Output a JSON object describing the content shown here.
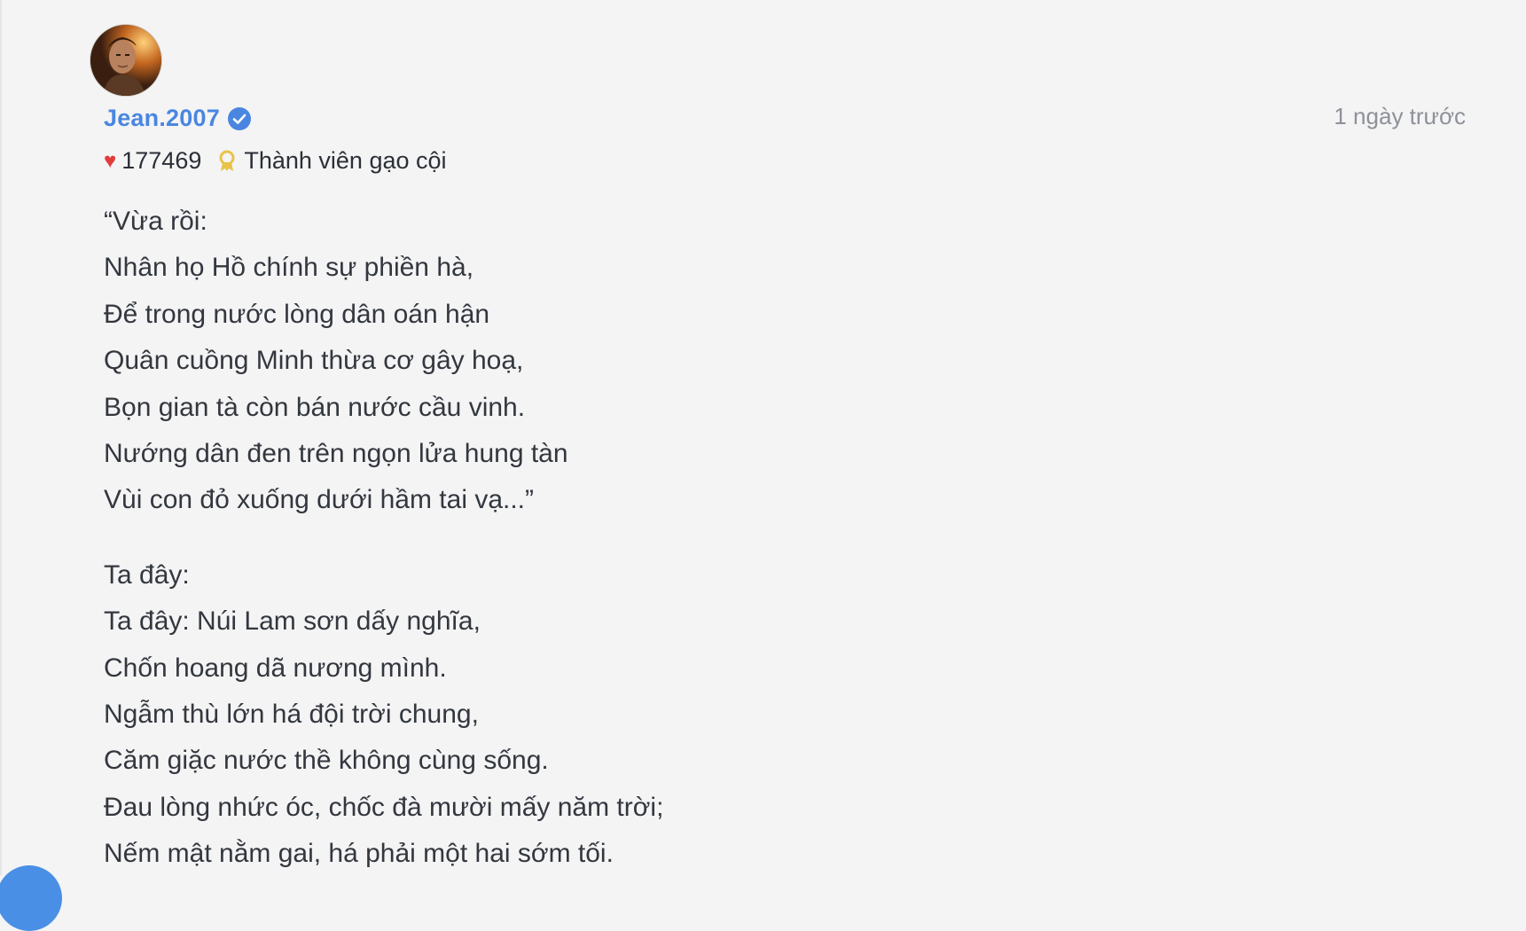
{
  "post": {
    "author": {
      "username": "Jean.2007",
      "verified": true,
      "likes": "177469",
      "rank": "Thành viên gạo cội"
    },
    "timestamp": "1 ngày trước",
    "stanzas": [
      {
        "lines": [
          "“Vừa rồi:",
          "Nhân họ Hồ chính sự phiền hà,",
          "Để trong nước lòng dân oán hận",
          "Quân cuồng Minh thừa cơ gây hoạ,",
          "Bọn gian tà còn bán nước cầu vinh.",
          "Nướng dân đen trên ngọn lửa hung tàn",
          "Vùi con đỏ xuống dưới hầm tai vạ...”"
        ]
      },
      {
        "lines": [
          "Ta đây:",
          "Ta đây: Núi Lam sơn dấy nghĩa,",
          "Chốn hoang dã nương mình.",
          "Ngẫm thù lớn há đội trời chung,",
          "Căm giặc nước thề không cùng sống.",
          "Đau lòng nhức óc, chốc đà mười mấy năm trời;",
          "Nếm mật nằm gai, há phải một hai sớm tối."
        ]
      }
    ]
  },
  "colors": {
    "username": "#4a86e0",
    "heart": "#e23b3b",
    "medal": "#e8c34a",
    "timestamp": "#8d9198",
    "background": "#f4f4f5"
  },
  "icons": {
    "verified": "verified-badge-icon",
    "likes": "heart-icon",
    "rank": "medal-icon"
  }
}
